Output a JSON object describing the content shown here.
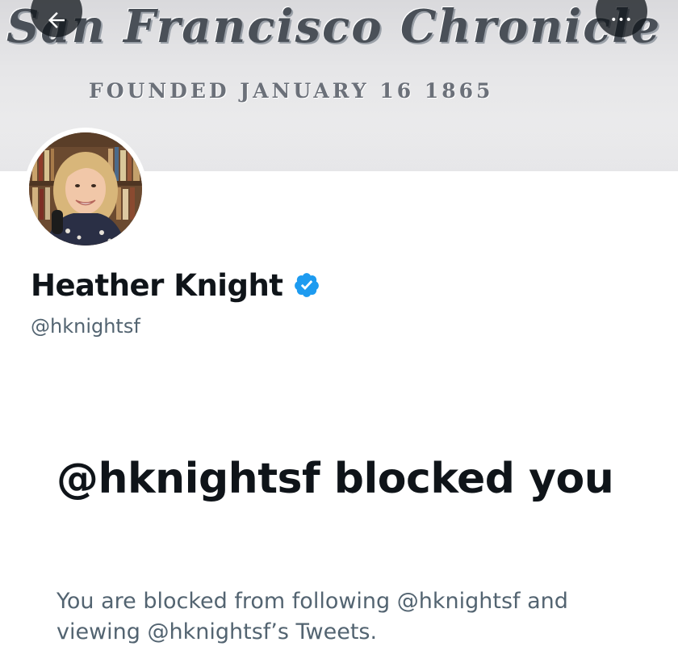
{
  "banner": {
    "masthead": "San Francisco Chronicle",
    "tagline": "FOUNDED JANUARY 16 1865"
  },
  "header": {
    "back_icon": "arrow-left-icon",
    "more_icon": "more-horizontal-icon",
    "more_label": "•••"
  },
  "profile": {
    "display_name": "Heather Knight",
    "verified_icon": "verified-badge-icon",
    "handle": "@hknightsf"
  },
  "blocked": {
    "title": "@hknightsf blocked you",
    "description": "You are blocked from following @hknightsf and viewing @hknightsf’s Tweets."
  },
  "colors": {
    "text_primary": "#0f1419",
    "text_secondary": "#536471",
    "verified_blue": "#1d9bf0",
    "overlay_button": "#0f1419"
  }
}
